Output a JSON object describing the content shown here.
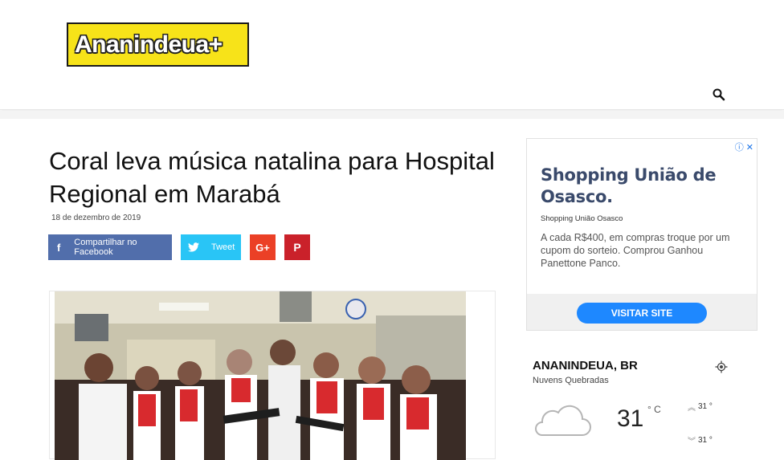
{
  "header": {
    "logo_text": "Ananindeua+",
    "brand_color": "#f7e319"
  },
  "article": {
    "title": "Coral leva música natalina para Hospital Regional em Marabá",
    "date": "18 de dezembro de 2019",
    "share": {
      "facebook_label": "Compartilhar no Facebook",
      "twitter_label": "Tweet",
      "googleplus_icon": "G+",
      "pinterest_icon": "P"
    },
    "image_icon": "photo-choir"
  },
  "ad": {
    "title": "Shopping União de Osasco.",
    "brand": "Shopping União Osasco",
    "body": "A cada R$400, em compras troque por um cupom do sorteio. Comprou Ganhou Panettone Panco.",
    "cta": "VISITAR SITE",
    "icons": "ⓘ ✕"
  },
  "weather": {
    "city": "ANANINDEUA, BR",
    "description": "Nuvens Quebradas",
    "temp": "31",
    "unit": "° C",
    "high": "31 °",
    "low": "31 °"
  },
  "colors": {
    "facebook": "#516eab",
    "twitter": "#29c5f6",
    "googleplus": "#eb4026",
    "pinterest": "#ca212a",
    "cta": "#1e88ff"
  }
}
